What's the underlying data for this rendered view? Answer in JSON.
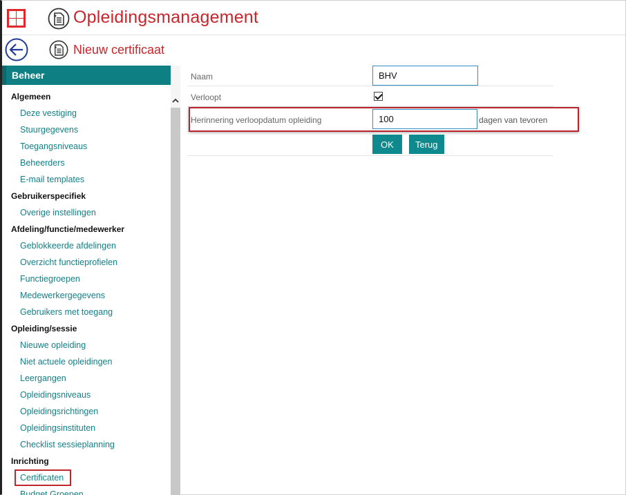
{
  "app": {
    "title": "Opleidingsmanagement",
    "accent_color": "#c8262b",
    "teal_color": "#0e7f83"
  },
  "page": {
    "title": "Nieuw certificaat"
  },
  "sidebar": {
    "header": "Beheer",
    "sections": [
      {
        "title": "Algemeen",
        "items": [
          "Deze vestiging",
          "Stuurgegevens",
          "Toegangsniveaus",
          "Beheerders",
          "E-mail templates"
        ]
      },
      {
        "title": "Gebruikerspecifiek",
        "items": [
          "Overige instellingen"
        ]
      },
      {
        "title": "Afdeling/functie/medewerker",
        "items": [
          "Geblokkeerde afdelingen",
          "Overzicht functieprofielen",
          "Functiegroepen",
          "Medewerkergegevens",
          "Gebruikers met toegang"
        ]
      },
      {
        "title": "Opleiding/sessie",
        "items": [
          "Nieuwe opleiding",
          "Niet actuele opleidingen",
          "Leergangen",
          "Opleidingsniveaus",
          "Opleidingsrichtingen",
          "Opleidingsinstituten",
          "Checklist sessieplanning"
        ]
      },
      {
        "title": "Inrichting",
        "items": [
          "Certificaten",
          "Budget Groepen"
        ]
      }
    ],
    "active_item": "Certificaten"
  },
  "form": {
    "name_label": "Naam",
    "name_value": "BHV",
    "expires_label": "Verloopt",
    "expires_checked": true,
    "reminder_label": "Herinnering verloopdatum opleiding",
    "reminder_value": "100",
    "reminder_suffix": "dagen van tevoren",
    "ok_label": "OK",
    "back_label": "Terug"
  },
  "icons": {
    "menu": "grid-icon",
    "app": "document-icon",
    "back": "back-arrow-icon",
    "scroll_up": "chevron-up-icon"
  }
}
